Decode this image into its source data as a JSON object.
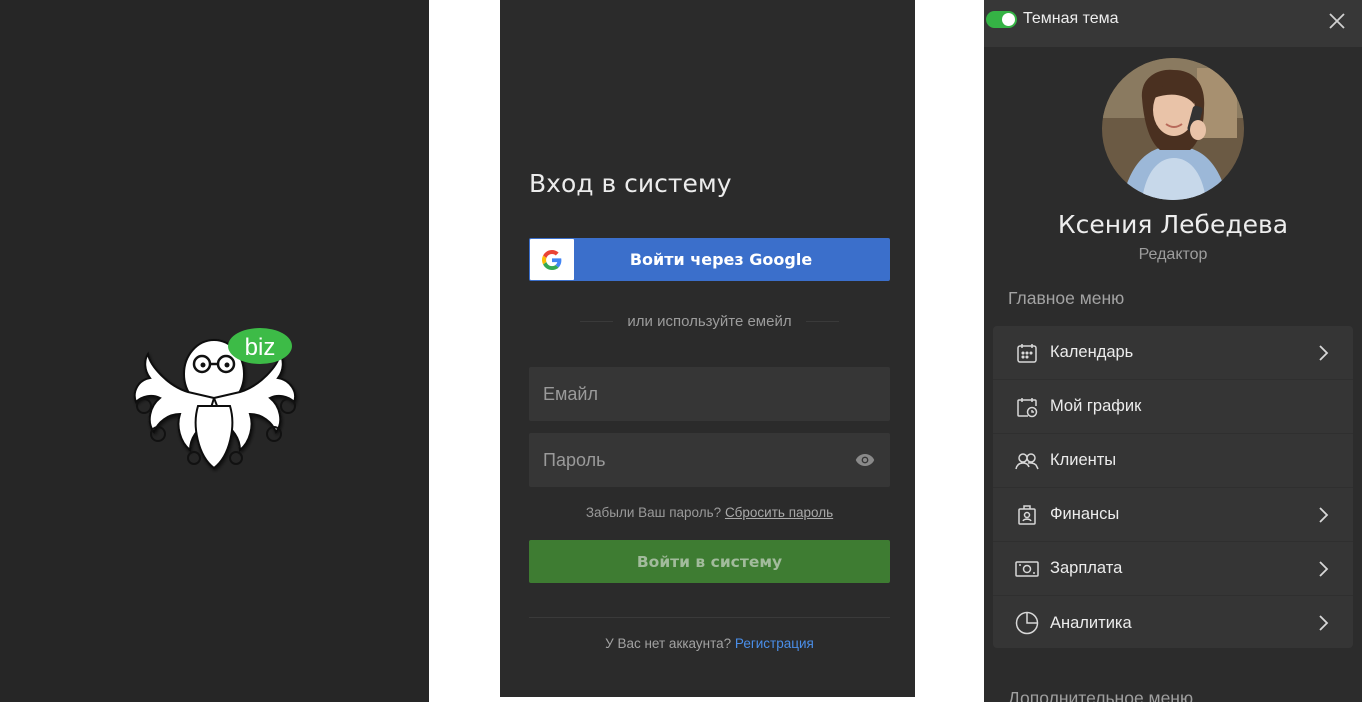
{
  "splash": {
    "logo_badge": "biz"
  },
  "login": {
    "title": "Вход в систему",
    "google_button": "Войти через Google",
    "divider_text": "или используйте емейл",
    "email_placeholder": "Емайл",
    "password_placeholder": "Пароль",
    "forgot_text": "Забыли Ваш пароль?",
    "reset_link": "Сбросить пароль",
    "submit_button": "Войти в систему",
    "no_account_text": "У Вас нет аккаунта?",
    "register_link": "Регистрация"
  },
  "menu": {
    "theme_label": "Темная тема",
    "theme_enabled": true,
    "user_name": "Ксения Лебедева",
    "user_role": "Редактор",
    "main_section": "Главное меню",
    "extra_section": "Дополнительное меню",
    "items": [
      {
        "label": "Календарь",
        "icon": "calendar-icon",
        "has_arrow": true
      },
      {
        "label": "Мой график",
        "icon": "schedule-icon",
        "has_arrow": false
      },
      {
        "label": "Клиенты",
        "icon": "clients-icon",
        "has_arrow": false
      },
      {
        "label": "Финансы",
        "icon": "finance-icon",
        "has_arrow": true
      },
      {
        "label": "Зарплата",
        "icon": "salary-icon",
        "has_arrow": true
      },
      {
        "label": "Аналитика",
        "icon": "analytics-icon",
        "has_arrow": true
      }
    ]
  },
  "colors": {
    "google_blue": "#3b6fcb",
    "submit_green": "#3e7c32",
    "toggle_green": "#35b345",
    "link_blue": "#4a8ee8",
    "badge_green": "#3dbb47"
  }
}
